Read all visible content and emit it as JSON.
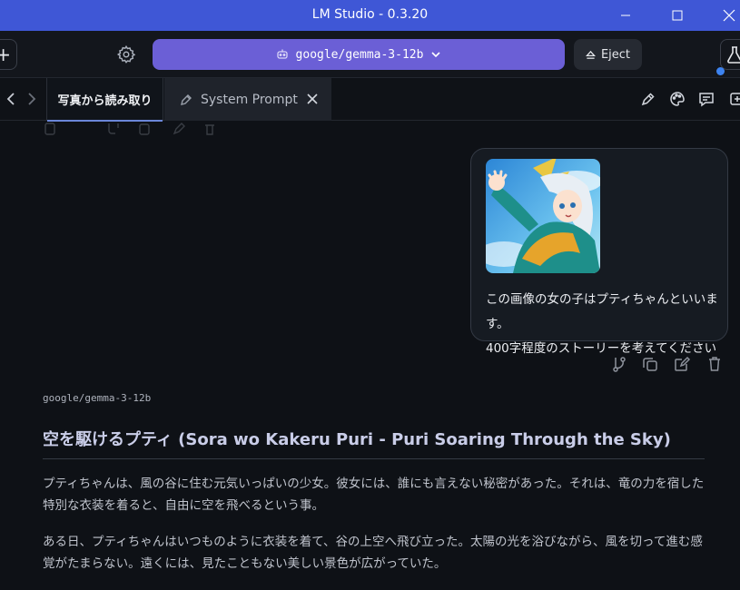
{
  "window": {
    "title": "LM Studio - 0.3.20"
  },
  "toolbar": {
    "new_symbol": "+",
    "model_name": "google/gemma-3-12b",
    "eject_label": "Eject"
  },
  "tabs": [
    {
      "label": "写真から読み取り",
      "active": true
    },
    {
      "label": "System Prompt",
      "active": false
    }
  ],
  "user_message": {
    "text_line1": "この画像の女の子はプティちゃんといいます。",
    "text_line2": "400字程度のストーリーを考えてください"
  },
  "response": {
    "model_label": "google/gemma-3-12b",
    "heading": "空を駆けるプティ (Sora wo Kakeru Puri - Puri Soaring Through the Sky)",
    "paragraph1": "プティちゃんは、風の谷に住む元気いっぱいの少女。彼女には、誰にも言えない秘密があった。それは、竜の力を宿した特別な衣装を着ると、自由に空を飛べるという事。",
    "paragraph2": "ある日、プティちゃんはいつものように衣装を着て、谷の上空へ飛び立った。太陽の光を浴びながら、風を切って進む感覚がたまらない。遠くには、見たこともない美しい景色が広がっていた。"
  },
  "colors": {
    "titlebar": "#3f57d6",
    "accent": "#6b5fd6",
    "background": "#0e1116",
    "status_dot": "#3d83f0"
  },
  "icons": [
    "gear-icon",
    "robot-icon",
    "chevron-down-icon",
    "eject-icon",
    "flask-icon",
    "chevron-left-icon",
    "chevron-right-icon",
    "pen-icon",
    "close-icon",
    "palette-icon",
    "message-icon",
    "branch-icon",
    "copy-icon",
    "edit-icon",
    "trash-icon"
  ]
}
